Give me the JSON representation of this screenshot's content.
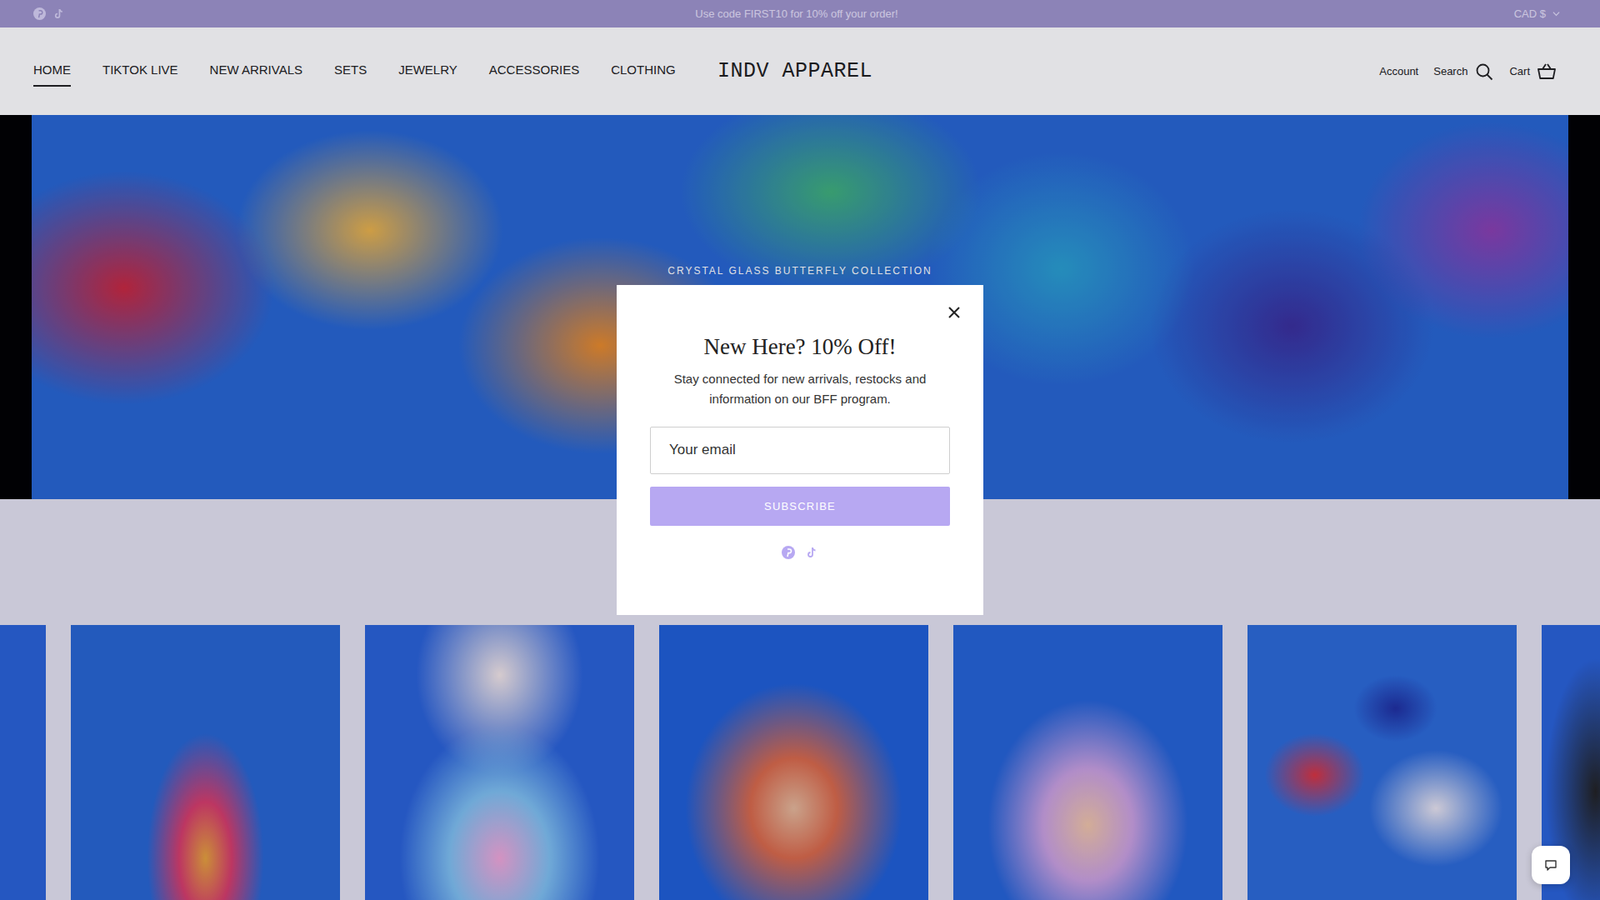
{
  "announcement": {
    "text": "Use code FIRST10 for 10% off your order!",
    "currency": "CAD $"
  },
  "nav": [
    {
      "label": "HOME",
      "selected": true
    },
    {
      "label": "TIKTOK LIVE",
      "selected": false
    },
    {
      "label": "NEW ARRIVALS",
      "selected": false
    },
    {
      "label": "SETS",
      "selected": false
    },
    {
      "label": "JEWELRY",
      "selected": false
    },
    {
      "label": "ACCESSORIES",
      "selected": false
    },
    {
      "label": "CLOTHING",
      "selected": false
    }
  ],
  "logo": "INDV APPAREL",
  "header_links": {
    "account": "Account",
    "search": "Search",
    "cart": "Cart"
  },
  "hero": {
    "kicker": "CRYSTAL GLASS BUTTERFLY COLLECTION"
  },
  "popup": {
    "title": "New Here? 10% Off!",
    "text": "Stay connected for new arrivals, restocks and information on our BFF program.",
    "email_placeholder": "Your email",
    "button": "SUBSCRIBE"
  }
}
